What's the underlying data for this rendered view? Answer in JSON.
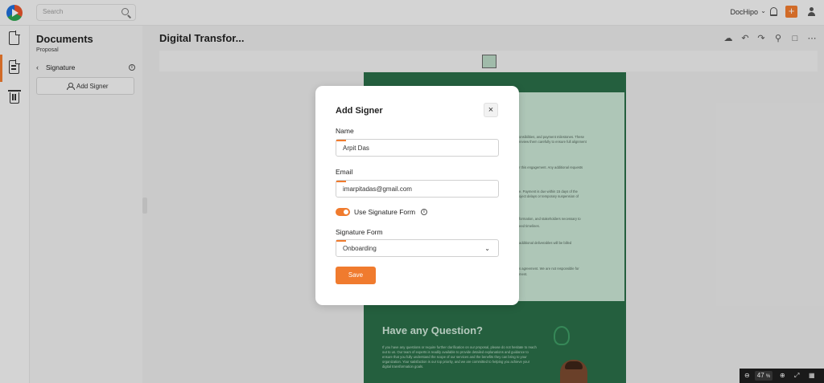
{
  "topbar": {
    "search_placeholder": "Search",
    "brand": "DocHipo",
    "plus": "+"
  },
  "panel": {
    "title": "Documents",
    "subtitle": "Proposal",
    "section": "Signature",
    "add_signer": "Add Signer"
  },
  "editor": {
    "title": "Digital Transfor...",
    "doc_heading": "Have any Question?",
    "doc_paragraph": "If you have any questions or require further clarification on our proposal, please do not hesitate to reach out to us. Our team of experts is readily available to provide detailed explanations and guidance to ensure that you fully understand the scope of our services and the benefits they can bring to your organization. Your satisfaction is our top priority, and we are committed to helping you achieve your digital transformation goals.",
    "doc_snippets": [
      "onsibilities, and payment milestones. These",
      "review them carefully to ensure full alignment",
      "r this engagement. Any additional requests",
      "e. Payment is due within 15 days of the",
      "oject delays or temporary suspension of",
      "formation, and stakeholders necessary to",
      "eed timelines.",
      "additional deliverables will be billed",
      "s agreement. We are not responsible for",
      "ment."
    ],
    "zoom_value": "47",
    "zoom_unit": "%"
  },
  "modal": {
    "title": "Add Signer",
    "close": "×",
    "name_label": "Name",
    "name_value": "Arpit Das",
    "email_label": "Email",
    "email_value": "imarpitadas@gmail.com",
    "toggle_label": "Use Signature Form",
    "toggle_on": true,
    "form_label": "Signature Form",
    "form_value": "Onboarding",
    "save": "Save"
  },
  "colors": {
    "accent": "#f07b2e",
    "doc_green": "#2a6e48",
    "doc_mint": "#c8e4d3"
  },
  "icons": [
    "logo-icon",
    "search-icon",
    "bell-icon",
    "plus-icon",
    "user-icon",
    "document-icon",
    "document-edit-icon",
    "trash-icon",
    "info-icon",
    "person-icon",
    "cloud-icon",
    "undo-icon",
    "redo-icon",
    "search-icon",
    "comment-icon",
    "more-icon",
    "zoom-out-icon",
    "zoom-in-icon",
    "fit-screen-icon",
    "fullscreen-icon",
    "grid-icon",
    "close-icon",
    "chevron-down-icon"
  ]
}
